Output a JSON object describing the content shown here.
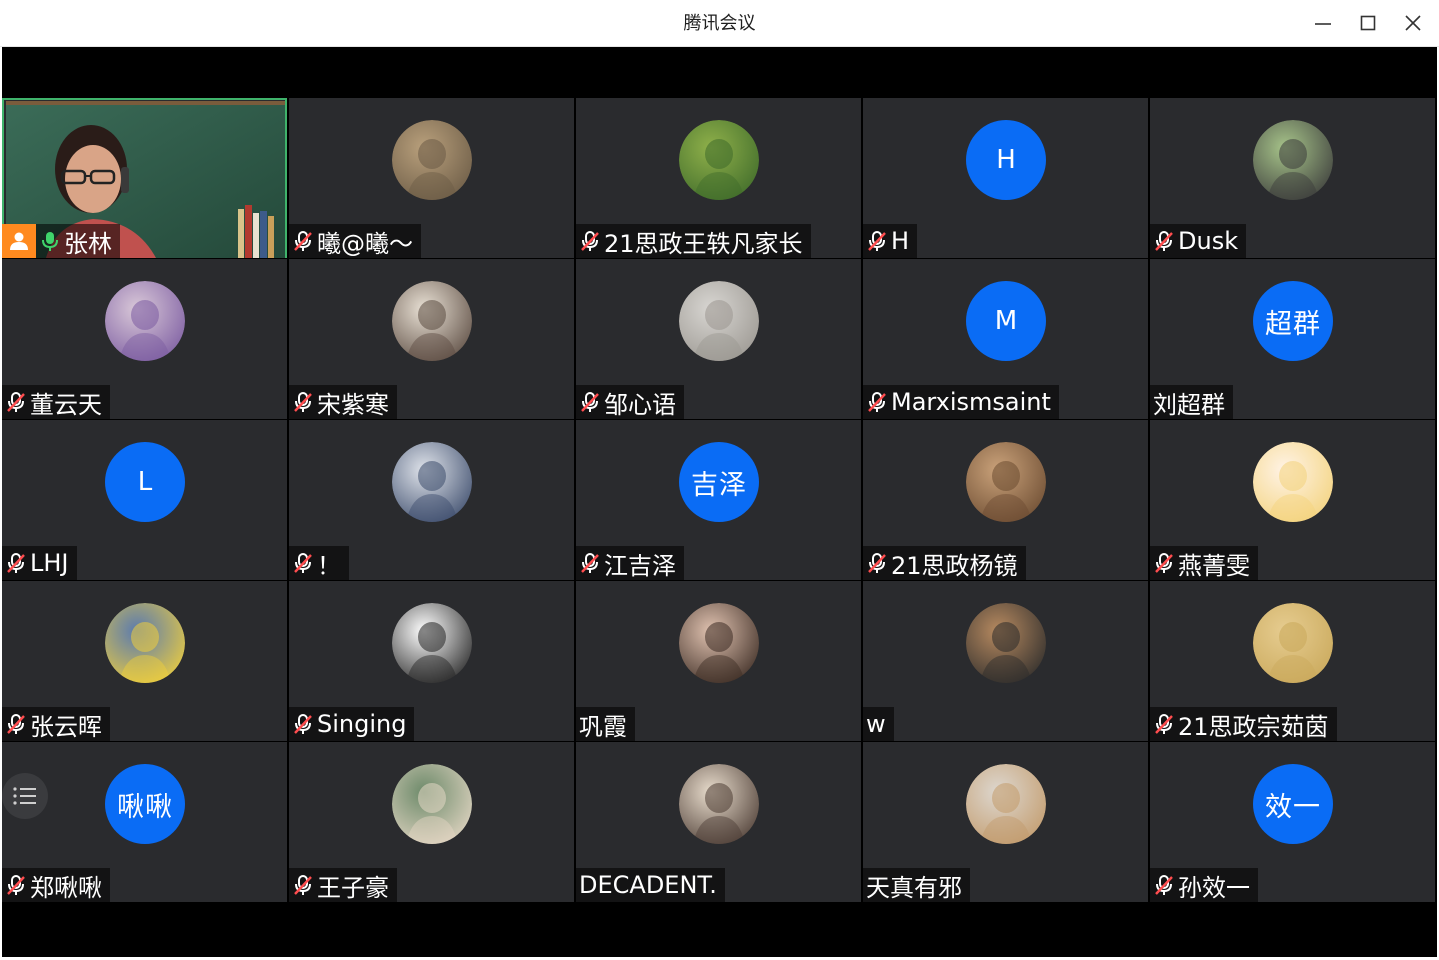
{
  "window": {
    "title": "腾讯会议",
    "controls": [
      "minimize",
      "maximize",
      "close"
    ]
  },
  "host": {
    "name": "张林",
    "mic": "on",
    "role_icon": "host-person-icon"
  },
  "participants": [
    {
      "name": "曦@曦～",
      "mic": "muted",
      "avatar": "photo"
    },
    {
      "name": "21思政王轶凡家长",
      "mic": "muted",
      "avatar": "photo"
    },
    {
      "name": "H",
      "mic": "muted",
      "avatar": "letter",
      "avatar_text": "H"
    },
    {
      "name": "Dusk",
      "mic": "muted",
      "avatar": "photo"
    },
    {
      "name": "董云天",
      "mic": "muted",
      "avatar": "photo"
    },
    {
      "name": "宋紫寒",
      "mic": "muted",
      "avatar": "photo"
    },
    {
      "name": "邹心语",
      "mic": "muted",
      "avatar": "photo"
    },
    {
      "name": "Marxismsaint",
      "mic": "muted",
      "avatar": "letter",
      "avatar_text": "M"
    },
    {
      "name": "刘超群",
      "mic": "none",
      "avatar": "letter",
      "avatar_text": "超群"
    },
    {
      "name": "LHJ",
      "mic": "muted",
      "avatar": "letter",
      "avatar_text": "L"
    },
    {
      "name": "！",
      "mic": "muted",
      "avatar": "photo"
    },
    {
      "name": "江吉泽",
      "mic": "muted",
      "avatar": "letter",
      "avatar_text": "吉泽"
    },
    {
      "name": "21思政杨镜",
      "mic": "muted",
      "avatar": "photo"
    },
    {
      "name": "燕菁雯",
      "mic": "muted",
      "avatar": "photo"
    },
    {
      "name": "张云晖",
      "mic": "muted",
      "avatar": "photo"
    },
    {
      "name": "Singing",
      "mic": "muted",
      "avatar": "photo"
    },
    {
      "name": "巩霞",
      "mic": "none",
      "avatar": "photo"
    },
    {
      "name": "w",
      "mic": "none",
      "avatar": "photo"
    },
    {
      "name": "21思政宗茹茵",
      "mic": "muted",
      "avatar": "photo"
    },
    {
      "name": "郑啾啾",
      "mic": "muted",
      "avatar": "letter",
      "avatar_text": "啾啾"
    },
    {
      "name": "王子豪",
      "mic": "muted",
      "avatar": "photo"
    },
    {
      "name": "DECADENT.",
      "mic": "none",
      "avatar": "photo"
    },
    {
      "name": "天真有邪",
      "mic": "none",
      "avatar": "photo"
    },
    {
      "name": "孙效一",
      "mic": "muted",
      "avatar": "letter",
      "avatar_text": "效一"
    }
  ],
  "colors": {
    "tile_bg": "#2a2b2e",
    "letter_avatar": "#0a6cf5",
    "active_border": "#3fb36b",
    "host_badge": "#ff8a1f",
    "mic_on": "#3fd46b"
  }
}
